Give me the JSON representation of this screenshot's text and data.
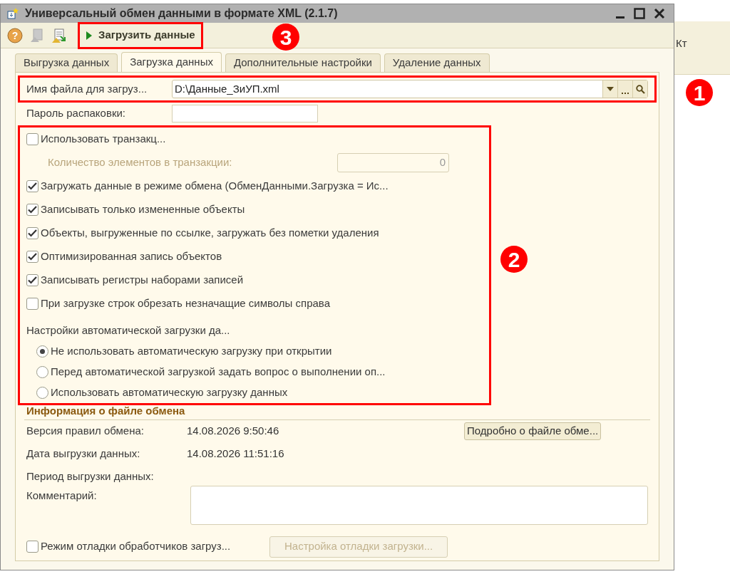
{
  "background": {
    "column_header": "Кт"
  },
  "window": {
    "title": "Универсальный обмен данными в формате XML (2.1.7)"
  },
  "toolbar": {
    "help": "?",
    "run_button": "Загрузить данные",
    "highlighted": true,
    "marker": "3"
  },
  "tabs": [
    {
      "label": "Выгрузка данных",
      "selected": false
    },
    {
      "label": "Загрузка данных",
      "selected": true
    },
    {
      "label": "Дополнительные настройки",
      "selected": false
    },
    {
      "label": "Удаление данных",
      "selected": false
    }
  ],
  "file_field": {
    "label": "Имя файла для загруз...",
    "value": "D:\\Данные_ЗиУП.xml",
    "highlighted": true,
    "marker": "1"
  },
  "password_field": {
    "label": "Пароль распаковки:"
  },
  "options": {
    "highlighted": true,
    "marker": "2",
    "items": [
      {
        "kind": "checkbox",
        "label": "Использовать транзакц...",
        "checked": false
      },
      {
        "kind": "number",
        "label": "Количество элементов в транзакции:",
        "value": "0",
        "disabled": true
      },
      {
        "kind": "checkbox",
        "label": "Загружать данные в режиме обмена (ОбменДанными.Загрузка = Ис...",
        "checked": true
      },
      {
        "kind": "checkbox",
        "label": "Записывать только измененные объекты",
        "checked": true
      },
      {
        "kind": "checkbox",
        "label": "Объекты, выгруженные по ссылке, загружать без пометки удаления",
        "checked": true
      },
      {
        "kind": "checkbox",
        "label": "Оптимизированная запись объектов",
        "checked": true
      },
      {
        "kind": "checkbox",
        "label": "Записывать регистры наборами записей",
        "checked": true
      },
      {
        "kind": "checkbox",
        "label": "При загрузке строк обрезать незначащие символы справа",
        "checked": false
      },
      {
        "kind": "heading",
        "label": "Настройки автоматической загрузки да..."
      },
      {
        "kind": "radio",
        "label": "Не использовать автоматическую загрузку при открытии",
        "selected": true
      },
      {
        "kind": "radio",
        "label": "Перед автоматической загрузкой задать вопрос о выполнении оп...",
        "selected": false
      },
      {
        "kind": "radio",
        "label": "Использовать автоматическую загрузку данных",
        "selected": false
      }
    ]
  },
  "file_info": {
    "title": "Информация о файле обмена",
    "rows": [
      {
        "label": "Версия правил обмена:",
        "value": "14.08.2026 9:50:46"
      },
      {
        "label": "Дата выгрузки данных:",
        "value": "14.08.2026 11:51:16"
      },
      {
        "label": "Период выгрузки данных:"
      }
    ],
    "details_button": "Подробно о файле обме...",
    "comment_label": "Комментарий:"
  },
  "debug": {
    "label": "Режим отладки обработчиков загруз...",
    "checked": false,
    "button": "Настройка отладки загрузки...",
    "button_disabled": true
  }
}
